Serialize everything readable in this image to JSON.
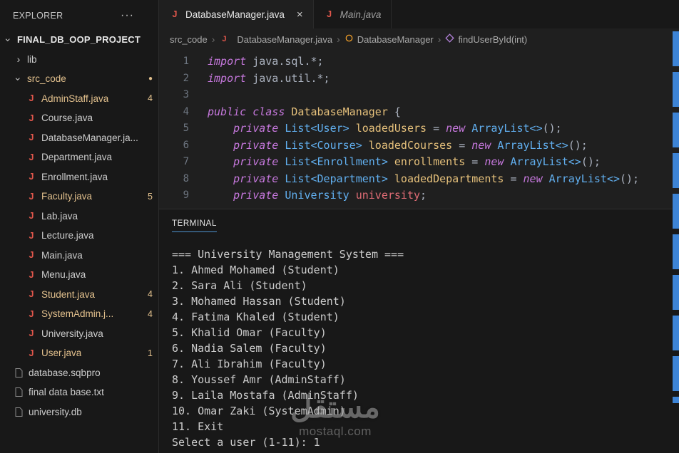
{
  "explorer": {
    "title": "EXPLORER",
    "more_icon": "···",
    "items": [
      {
        "name": "FINAL_DB_OOP_PROJECT",
        "type": "root-folder",
        "badge": ""
      },
      {
        "name": "lib",
        "type": "folder-collapsed",
        "badge": ""
      },
      {
        "name": "src_code",
        "type": "folder-expanded",
        "modified": true,
        "badge": "●"
      },
      {
        "name": "AdminStaff.java",
        "type": "java-file",
        "modified": true,
        "badge": "4"
      },
      {
        "name": "Course.java",
        "type": "java-file",
        "badge": ""
      },
      {
        "name": "DatabaseManager.ja...",
        "type": "java-file",
        "badge": ""
      },
      {
        "name": "Department.java",
        "type": "java-file",
        "badge": ""
      },
      {
        "name": "Enrollment.java",
        "type": "java-file",
        "badge": ""
      },
      {
        "name": "Faculty.java",
        "type": "java-file",
        "modified": true,
        "badge": "5"
      },
      {
        "name": "Lab.java",
        "type": "java-file",
        "badge": ""
      },
      {
        "name": "Lecture.java",
        "type": "java-file",
        "badge": ""
      },
      {
        "name": "Main.java",
        "type": "java-file",
        "badge": ""
      },
      {
        "name": "Menu.java",
        "type": "java-file",
        "badge": ""
      },
      {
        "name": "Student.java",
        "type": "java-file",
        "modified": true,
        "badge": "4"
      },
      {
        "name": "SystemAdmin.j...",
        "type": "java-file",
        "modified": true,
        "badge": "4"
      },
      {
        "name": "University.java",
        "type": "java-file",
        "badge": ""
      },
      {
        "name": "User.java",
        "type": "java-file",
        "modified": true,
        "badge": "1"
      },
      {
        "name": "database.sqbpro",
        "type": "file",
        "badge": ""
      },
      {
        "name": "final data base.txt",
        "type": "file",
        "badge": ""
      },
      {
        "name": "university.db",
        "type": "file",
        "badge": ""
      }
    ]
  },
  "tabs": {
    "items": [
      {
        "label": "DatabaseManager.java",
        "close": "×",
        "active": true
      },
      {
        "label": "Main.java",
        "active": false,
        "preview": true
      }
    ]
  },
  "breadcrumb": {
    "separator": "›",
    "items": [
      "src_code",
      "DatabaseManager.java",
      "DatabaseManager",
      "findUserById(int)"
    ]
  },
  "editor": {
    "lines": [
      {
        "n": "1",
        "tokens": [
          {
            "c": "kw",
            "t": "import"
          },
          {
            "c": "pln",
            "t": " java.sql.*;"
          }
        ]
      },
      {
        "n": "2",
        "tokens": [
          {
            "c": "kw",
            "t": "import"
          },
          {
            "c": "pln",
            "t": " java.util.*;"
          }
        ]
      },
      {
        "n": "3",
        "tokens": []
      },
      {
        "n": "4",
        "tokens": [
          {
            "c": "kw",
            "t": "public class "
          },
          {
            "c": "cls",
            "t": "DatabaseManager"
          },
          {
            "c": "pln",
            "t": " {"
          }
        ]
      },
      {
        "n": "5",
        "tokens": [
          {
            "c": "pln",
            "t": "    "
          },
          {
            "c": "kw",
            "t": "private"
          },
          {
            "c": "pln",
            "t": " "
          },
          {
            "c": "typ",
            "t": "List<User>"
          },
          {
            "c": "pln",
            "t": " "
          },
          {
            "c": "var",
            "t": "loadedUsers"
          },
          {
            "c": "pln",
            "t": " = "
          },
          {
            "c": "kw",
            "t": "new"
          },
          {
            "c": "pln",
            "t": " "
          },
          {
            "c": "typ",
            "t": "ArrayList<>"
          },
          {
            "c": "pln",
            "t": "();"
          }
        ]
      },
      {
        "n": "6",
        "tokens": [
          {
            "c": "pln",
            "t": "    "
          },
          {
            "c": "kw",
            "t": "private"
          },
          {
            "c": "pln",
            "t": " "
          },
          {
            "c": "typ",
            "t": "List<Course>"
          },
          {
            "c": "pln",
            "t": " "
          },
          {
            "c": "var",
            "t": "loadedCourses"
          },
          {
            "c": "pln",
            "t": " = "
          },
          {
            "c": "kw",
            "t": "new"
          },
          {
            "c": "pln",
            "t": " "
          },
          {
            "c": "typ",
            "t": "ArrayList<>"
          },
          {
            "c": "pln",
            "t": "();"
          }
        ]
      },
      {
        "n": "7",
        "tokens": [
          {
            "c": "pln",
            "t": "    "
          },
          {
            "c": "kw",
            "t": "private"
          },
          {
            "c": "pln",
            "t": " "
          },
          {
            "c": "typ",
            "t": "List<Enrollment>"
          },
          {
            "c": "pln",
            "t": " "
          },
          {
            "c": "var",
            "t": "enrollments"
          },
          {
            "c": "pln",
            "t": " = "
          },
          {
            "c": "kw",
            "t": "new"
          },
          {
            "c": "pln",
            "t": " "
          },
          {
            "c": "typ",
            "t": "ArrayList<>"
          },
          {
            "c": "pln",
            "t": "();"
          }
        ]
      },
      {
        "n": "8",
        "tokens": [
          {
            "c": "pln",
            "t": "    "
          },
          {
            "c": "kw",
            "t": "private"
          },
          {
            "c": "pln",
            "t": " "
          },
          {
            "c": "typ",
            "t": "List<Department>"
          },
          {
            "c": "pln",
            "t": " "
          },
          {
            "c": "var",
            "t": "loadedDepartments"
          },
          {
            "c": "pln",
            "t": " = "
          },
          {
            "c": "kw",
            "t": "new"
          },
          {
            "c": "pln",
            "t": " "
          },
          {
            "c": "typ",
            "t": "ArrayList<>"
          },
          {
            "c": "pln",
            "t": "();"
          }
        ]
      },
      {
        "n": "9",
        "tokens": [
          {
            "c": "pln",
            "t": "    "
          },
          {
            "c": "kw",
            "t": "private"
          },
          {
            "c": "pln",
            "t": " "
          },
          {
            "c": "typ",
            "t": "University"
          },
          {
            "c": "pln",
            "t": " "
          },
          {
            "c": "red",
            "t": "university"
          },
          {
            "c": "pln",
            "t": ";"
          }
        ]
      }
    ]
  },
  "panel": {
    "tab": "TERMINAL",
    "lines": [
      "=== University Management System ===",
      "1. Ahmed Mohamed (Student)",
      "2. Sara Ali (Student)",
      "3. Mohamed Hassan (Student)",
      "4. Fatima Khaled (Student)",
      "5. Khalid Omar (Faculty)",
      "6. Nadia Salem (Faculty)",
      "7. Ali Ibrahim (Faculty)",
      "8. Youssef Amr (AdminStaff)",
      "9. Laila Mostafa (AdminStaff)",
      "10. Omar Zaki (SystemAdmin)",
      "11. Exit",
      "Select a user (1-11): 1"
    ]
  },
  "watermark": {
    "text": "مستقل",
    "domain": "mostaql.com"
  },
  "colors": {
    "accent_blue": "#3d84d6",
    "git_modified": "#e2c08d",
    "java_icon": "#e2574c",
    "keyword": "#c678dd",
    "type": "#61afef",
    "class_name": "#e5c07b",
    "variable": "#e06c75",
    "sidebar_bg": "#181818",
    "editor_bg": "#1f1f1f"
  }
}
